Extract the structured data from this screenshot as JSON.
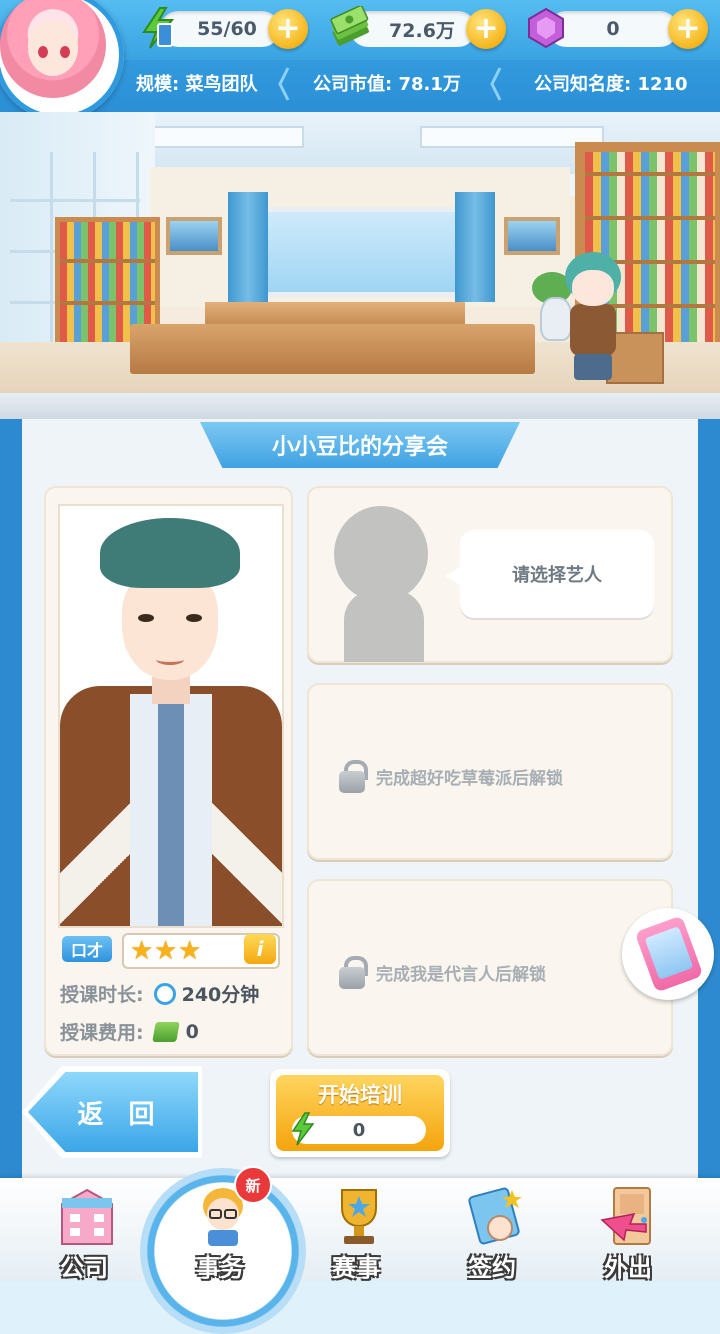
{
  "hud": {
    "energy": "55/60",
    "money": "72.6万",
    "gems": "0",
    "scale_label": "规模: 菜鸟团队",
    "market_value_label": "公司市值: 78.1万",
    "fame_label": "公司知名度: 1210",
    "colors": {
      "bar": "#3aa3e3",
      "plus": "#f6b51c"
    }
  },
  "panel": {
    "title": "小小豆比的分享会",
    "teacher": {
      "skill_tag": "口才",
      "stars": 3,
      "duration_label": "授课时长:",
      "duration_value": "240分钟",
      "fee_label": "授课费用:",
      "fee_value": "0"
    },
    "select_prompt": "请选择艺人",
    "locked_slots": [
      "完成超好吃草莓派后解锁",
      "完成我是代言人后解锁"
    ]
  },
  "actions": {
    "back_label": "返 回",
    "start_label": "开始培训",
    "start_cost": "0"
  },
  "nav": {
    "items": [
      {
        "label": "公司",
        "icon": "company-building-icon"
      },
      {
        "label": "事务",
        "icon": "manager-icon"
      },
      {
        "label": "赛事",
        "icon": "trophy-icon"
      },
      {
        "label": "签约",
        "icon": "contract-icon"
      },
      {
        "label": "外出",
        "icon": "door-exit-icon"
      }
    ],
    "active": "事务",
    "new_badge": "新"
  }
}
